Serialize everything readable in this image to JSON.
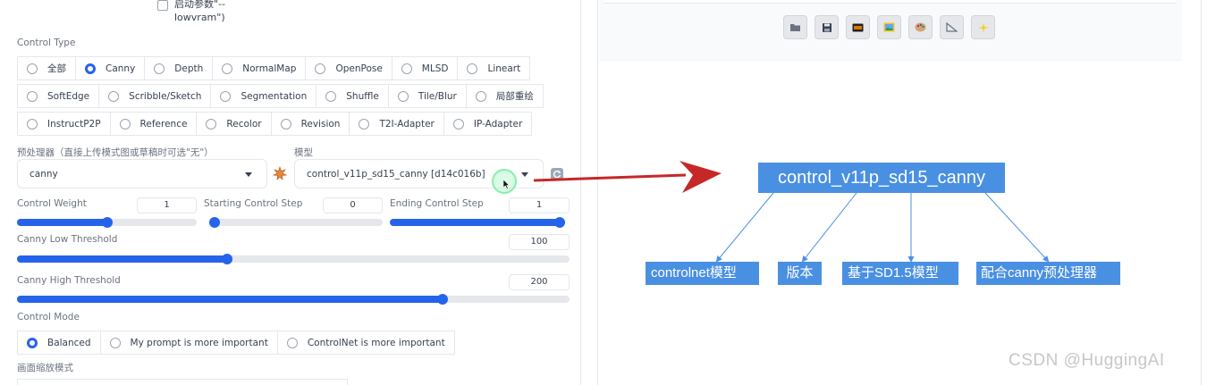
{
  "lowvram": {
    "label": "启动参数\"--lowvram\")"
  },
  "control_type": {
    "label": "Control Type",
    "rows": [
      [
        {
          "label": "全部",
          "selected": false
        },
        {
          "label": "Canny",
          "selected": true
        },
        {
          "label": "Depth",
          "selected": false
        },
        {
          "label": "NormalMap",
          "selected": false
        },
        {
          "label": "OpenPose",
          "selected": false
        },
        {
          "label": "MLSD",
          "selected": false
        },
        {
          "label": "Lineart",
          "selected": false
        }
      ],
      [
        {
          "label": "SoftEdge",
          "selected": false
        },
        {
          "label": "Scribble/Sketch",
          "selected": false
        },
        {
          "label": "Segmentation",
          "selected": false
        },
        {
          "label": "Shuffle",
          "selected": false
        },
        {
          "label": "Tile/Blur",
          "selected": false
        },
        {
          "label": "局部重绘",
          "selected": false
        }
      ],
      [
        {
          "label": "InstructP2P",
          "selected": false
        },
        {
          "label": "Reference",
          "selected": false
        },
        {
          "label": "Recolor",
          "selected": false
        },
        {
          "label": "Revision",
          "selected": false
        },
        {
          "label": "T2I-Adapter",
          "selected": false
        },
        {
          "label": "IP-Adapter",
          "selected": false
        }
      ]
    ]
  },
  "preprocessor": {
    "label": "预处理器（直接上传模式图或草稿时可选\"无\"）",
    "value": "canny"
  },
  "model": {
    "label": "模型",
    "value": "control_v11p_sd15_canny [d14c016b]"
  },
  "sliders": {
    "control_weight": {
      "label": "Control Weight",
      "value": "1",
      "fraction": 0.5
    },
    "starting_step": {
      "label": "Starting Control Step",
      "value": "0",
      "fraction": 0.0
    },
    "ending_step": {
      "label": "Ending Control Step",
      "value": "1",
      "fraction": 1.0
    },
    "canny_low": {
      "label": "Canny Low Threshold",
      "value": "100",
      "fraction": 0.38
    },
    "canny_high": {
      "label": "Canny High Threshold",
      "value": "200",
      "fraction": 0.77
    }
  },
  "control_mode": {
    "label": "Control Mode",
    "options": [
      {
        "label": "Balanced",
        "selected": true
      },
      {
        "label": "My prompt is more important",
        "selected": false
      },
      {
        "label": "ControlNet is more important",
        "selected": false
      }
    ]
  },
  "resize_mode": {
    "label": "画面缩放模式"
  },
  "annotation": {
    "main": "control_v11p_sd15_canny",
    "parts": [
      "controlnet模型",
      "版本",
      "基于SD1.5模型",
      "配合canny预处理器"
    ]
  },
  "watermark": "CSDN @HuggingAI",
  "colors": {
    "accent": "#2563eb",
    "annotation_box": "#4a90e2",
    "arrow": "#c62828"
  },
  "toolbar_icons": [
    "folder-icon",
    "save-icon",
    "film-icon",
    "image-icon",
    "palette-icon",
    "ruler-icon",
    "sparkle-icon"
  ]
}
